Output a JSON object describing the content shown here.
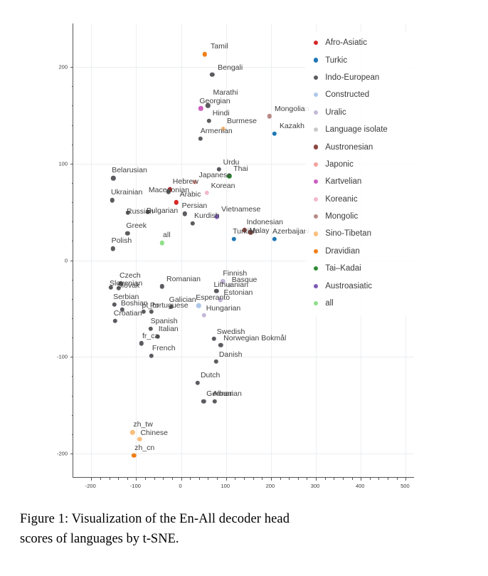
{
  "figure": {
    "caption_line1": "Figure 1:  Visualization of the En-All decoder head",
    "caption_line2": "scores of languages by t-SNE."
  },
  "axes": {
    "x_ticks": [
      "-200",
      "-100",
      "0",
      "100",
      "200",
      "300",
      "400",
      "500"
    ],
    "y_ticks": [
      "200",
      "100",
      "0",
      "-100",
      "-200"
    ],
    "xlim": [
      -240,
      520
    ],
    "ylim": [
      -225,
      245
    ],
    "grid": true
  },
  "legend": {
    "position": "upper-right",
    "items": [
      {
        "label": "Afro-Asiatic",
        "color": "#d62728"
      },
      {
        "label": "Turkic",
        "color": "#1f77b4"
      },
      {
        "label": "Indo-European",
        "color": "#5b5b60"
      },
      {
        "label": "Constructed",
        "color": "#aec7e8"
      },
      {
        "label": "Uralic",
        "color": "#c5b9d8"
      },
      {
        "label": "Language isolate",
        "color": "#c9c9cc"
      },
      {
        "label": "Austronesian",
        "color": "#8c4641"
      },
      {
        "label": "Japonic",
        "color": "#f4a09a"
      },
      {
        "label": "Kartvelian",
        "color": "#cd5fc0"
      },
      {
        "label": "Koreanic",
        "color": "#f2b8cb"
      },
      {
        "label": "Mongolic",
        "color": "#b78b85"
      },
      {
        "label": "Sino-Tibetan",
        "color": "#fbbf7f"
      },
      {
        "label": "Dravidian",
        "color": "#f07f18"
      },
      {
        "label": "Tai–Kadai",
        "color": "#2d8a33"
      },
      {
        "label": "Austroasiatic",
        "color": "#7e5bb5"
      },
      {
        "label": "all",
        "color": "#8fe08a"
      }
    ]
  },
  "chart_data": {
    "type": "scatter",
    "title": "",
    "xlabel": "",
    "ylabel": "",
    "xlim": [
      -240,
      520
    ],
    "ylim": [
      -225,
      245
    ],
    "grid": true,
    "legend_position": "upper-right",
    "points": [
      {
        "label": "Tamil",
        "x": 53,
        "y": 213,
        "family": "Dravidian",
        "color": "#f07f18",
        "lx": 8,
        "ly": -11
      },
      {
        "label": "Bengali",
        "x": 69,
        "y": 192,
        "family": "Indo-European",
        "color": "#5b5b60",
        "lx": 8,
        "ly": -10
      },
      {
        "label": "Marathi",
        "x": 60,
        "y": 160,
        "family": "Indo-European",
        "color": "#5b5b60",
        "lx": 7,
        "ly": -18
      },
      {
        "label": "Georgian",
        "x": 44,
        "y": 157,
        "family": "Kartvelian",
        "color": "#cd5fc0",
        "lx": -2,
        "ly": -10
      },
      {
        "label": "Mongolian",
        "x": 197,
        "y": 149,
        "family": "Mongolic",
        "color": "#b78b85",
        "lx": 7,
        "ly": -10
      },
      {
        "label": "Hindi",
        "x": 62,
        "y": 144,
        "family": "Indo-European",
        "color": "#5b5b60",
        "lx": 5,
        "ly": -11
      },
      {
        "label": "Burmese",
        "x": 94,
        "y": 136,
        "family": "Sino-Tibetan",
        "color": "#fbbf7f",
        "lx": 5,
        "ly": -11
      },
      {
        "label": "Kazakh",
        "x": 208,
        "y": 131,
        "family": "Turkic",
        "color": "#1f77b4",
        "lx": 7,
        "ly": -11
      },
      {
        "label": "Armenian",
        "x": 43,
        "y": 126,
        "family": "Indo-European",
        "color": "#5b5b60",
        "lx": 0,
        "ly": -11
      },
      {
        "label": "Urdu",
        "x": 84,
        "y": 94,
        "family": "Indo-European",
        "color": "#5b5b60",
        "lx": 6,
        "ly": -10
      },
      {
        "label": "Thai",
        "x": 107,
        "y": 87,
        "family": "Tai–Kadai",
        "color": "#2d8a33",
        "lx": 6,
        "ly": -10
      },
      {
        "label": "Belarusian",
        "x": -151,
        "y": 85,
        "family": "Indo-European",
        "color": "#5b5b60",
        "lx": -2,
        "ly": -11
      },
      {
        "label": "Japanese",
        "x": 30,
        "y": 81,
        "family": "Japonic",
        "color": "#f4a09a",
        "lx": 6,
        "ly": -10
      },
      {
        "label": "Hebrew",
        "x": -25,
        "y": 73,
        "family": "Afro-Asiatic",
        "color": "#d62728",
        "lx": 4,
        "ly": -11
      },
      {
        "label": "Macedonian",
        "x": -28,
        "y": 71,
        "family": "Indo-European",
        "color": "#5b5b60",
        "lx": -28,
        "ly": -2
      },
      {
        "label": "Korean",
        "x": 57,
        "y": 70,
        "family": "Koreanic",
        "color": "#f2b8cb",
        "lx": 6,
        "ly": -10
      },
      {
        "label": "Ukrainian",
        "x": -153,
        "y": 62,
        "family": "Indo-European",
        "color": "#5b5b60",
        "lx": -2,
        "ly": -11
      },
      {
        "label": "Arabic",
        "x": -11,
        "y": 60,
        "family": "Afro-Asiatic",
        "color": "#d62728",
        "lx": 5,
        "ly": -11
      },
      {
        "label": "Bulgarian",
        "x": -74,
        "y": 50,
        "family": "Indo-European",
        "color": "#5b5b60",
        "lx": -2,
        "ly": -2
      },
      {
        "label": "Russian",
        "x": -118,
        "y": 49,
        "family": "Indo-European",
        "color": "#5b5b60",
        "lx": -2,
        "ly": -2
      },
      {
        "label": "Persian",
        "x": 8,
        "y": 48,
        "family": "Indo-European",
        "color": "#5b5b60",
        "lx": -4,
        "ly": -11
      },
      {
        "label": "Vietnamese",
        "x": 80,
        "y": 45,
        "family": "Austroasiatic",
        "color": "#7e5bb5",
        "lx": 6,
        "ly": -10
      },
      {
        "label": "Kurdish",
        "x": 26,
        "y": 38,
        "family": "Indo-European",
        "color": "#5b5b60",
        "lx": 2,
        "ly": -11
      },
      {
        "label": "Indonesian",
        "x": 141,
        "y": 31,
        "family": "Austronesian",
        "color": "#8c4641",
        "lx": 3,
        "ly": -11
      },
      {
        "label": "Malay",
        "x": 155,
        "y": 29,
        "family": "Austronesian",
        "color": "#8c4641",
        "lx": -2,
        "ly": -2
      },
      {
        "label": "Greek",
        "x": -119,
        "y": 28,
        "family": "Indo-European",
        "color": "#5b5b60",
        "lx": -2,
        "ly": -11
      },
      {
        "label": "Turkish",
        "x": 118,
        "y": 22,
        "family": "Turkic",
        "color": "#1f77b4",
        "lx": -2,
        "ly": -11
      },
      {
        "label": "Azerbaijani",
        "x": 208,
        "y": 22,
        "family": "Turkic",
        "color": "#1f77b4",
        "lx": -3,
        "ly": -11
      },
      {
        "label": "all",
        "x": -42,
        "y": 18,
        "family": "all",
        "color": "#8fe08a",
        "lx": 1,
        "ly": -11
      },
      {
        "label": "Polish",
        "x": -152,
        "y": 12,
        "family": "Indo-European",
        "color": "#5b5b60",
        "lx": -2,
        "ly": -11
      },
      {
        "label": "Czech",
        "x": -134,
        "y": -24,
        "family": "Indo-European",
        "color": "#5b5b60",
        "lx": -2,
        "ly": -11
      },
      {
        "label": "Slovenian",
        "x": -156,
        "y": -28,
        "family": "Indo-European",
        "color": "#5b5b60",
        "lx": -2,
        "ly": -6
      },
      {
        "label": "Slovak",
        "x": -139,
        "y": -29,
        "family": "Indo-European",
        "color": "#5b5b60",
        "lx": -2,
        "ly": -4
      },
      {
        "label": "Romanian",
        "x": -42,
        "y": -27,
        "family": "Indo-European",
        "color": "#5b5b60",
        "lx": 6,
        "ly": -10
      },
      {
        "label": "Finnish",
        "x": 93,
        "y": -22,
        "family": "Uralic",
        "color": "#c5b9d8",
        "lx": 0,
        "ly": -11
      },
      {
        "label": "Basque",
        "x": 108,
        "y": -26,
        "family": "Language isolate",
        "color": "#c9c9cc",
        "lx": 3,
        "ly": -8
      },
      {
        "label": "Lithuanian",
        "x": 79,
        "y": -32,
        "family": "Indo-European",
        "color": "#5b5b60",
        "lx": -4,
        "ly": -9
      },
      {
        "label": "Estonian",
        "x": 87,
        "y": -41,
        "family": "Uralic",
        "color": "#c5b9d8",
        "lx": 5,
        "ly": -10
      },
      {
        "label": "Serbian",
        "x": -148,
        "y": -46,
        "family": "Indo-European",
        "color": "#5b5b60",
        "lx": -2,
        "ly": -11
      },
      {
        "label": "Boshian",
        "x": -131,
        "y": -51,
        "family": "Indo-European",
        "color": "#5b5b60",
        "lx": -2,
        "ly": -9
      },
      {
        "label": "Galician",
        "x": -22,
        "y": -48,
        "family": "Indo-European",
        "color": "#5b5b60",
        "lx": -3,
        "ly": -10
      },
      {
        "label": "Esperanto",
        "x": 39,
        "y": -47,
        "family": "Constructed",
        "color": "#aec7e8",
        "lx": -4,
        "ly": -11
      },
      {
        "label": "pt_br",
        "x": -84,
        "y": -53,
        "family": "Indo-European",
        "color": "#5b5b60",
        "lx": -2,
        "ly": -9
      },
      {
        "label": "Portuguese",
        "x": -66,
        "y": -53,
        "family": "Indo-European",
        "color": "#5b5b60",
        "lx": -2,
        "ly": -9
      },
      {
        "label": "Hungarian",
        "x": 51,
        "y": -57,
        "family": "Uralic",
        "color": "#c5b9d8",
        "lx": 3,
        "ly": -10
      },
      {
        "label": "Croatian",
        "x": -147,
        "y": -63,
        "family": "Indo-European",
        "color": "#5b5b60",
        "lx": -2,
        "ly": -11
      },
      {
        "label": "Spanish",
        "x": -68,
        "y": -71,
        "family": "Indo-European",
        "color": "#5b5b60",
        "lx": 0,
        "ly": -11
      },
      {
        "label": "Italian",
        "x": -52,
        "y": -79,
        "family": "Indo-European",
        "color": "#5b5b60",
        "lx": 1,
        "ly": -11
      },
      {
        "label": "Swedish",
        "x": 73,
        "y": -81,
        "family": "Indo-European",
        "color": "#5b5b60",
        "lx": 4,
        "ly": -10
      },
      {
        "label": "Norwegian Bokmål",
        "x": 88,
        "y": -88,
        "family": "Indo-European",
        "color": "#5b5b60",
        "lx": 4,
        "ly": -10
      },
      {
        "label": "fr_ca",
        "x": -88,
        "y": -86,
        "family": "Indo-European",
        "color": "#5b5b60",
        "lx": 1,
        "ly": -10
      },
      {
        "label": "French",
        "x": -66,
        "y": -99,
        "family": "Indo-European",
        "color": "#5b5b60",
        "lx": 1,
        "ly": -11
      },
      {
        "label": "Danish",
        "x": 78,
        "y": -105,
        "family": "Indo-European",
        "color": "#5b5b60",
        "lx": 4,
        "ly": -10
      },
      {
        "label": "Dutch",
        "x": 37,
        "y": -127,
        "family": "Indo-European",
        "color": "#5b5b60",
        "lx": 4,
        "ly": -11
      },
      {
        "label": "German",
        "x": 50,
        "y": -146,
        "family": "Indo-European",
        "color": "#5b5b60",
        "lx": 4,
        "ly": -11
      },
      {
        "label": "Albanian",
        "x": 75,
        "y": -146,
        "family": "Indo-European",
        "color": "#5b5b60",
        "lx": -3,
        "ly": -11
      },
      {
        "label": "zh_tw",
        "x": -108,
        "y": -178,
        "family": "Sino-Tibetan",
        "color": "#fbbf7f",
        "lx": 1,
        "ly": -11
      },
      {
        "label": "Chinese",
        "x": -92,
        "y": -185,
        "family": "Sino-Tibetan",
        "color": "#fbbf7f",
        "lx": 1,
        "ly": -9
      },
      {
        "label": "zh_cn",
        "x": -105,
        "y": -202,
        "family": "Sino-Tibetan",
        "color": "#f07f18",
        "lx": 1,
        "ly": -11
      }
    ]
  }
}
